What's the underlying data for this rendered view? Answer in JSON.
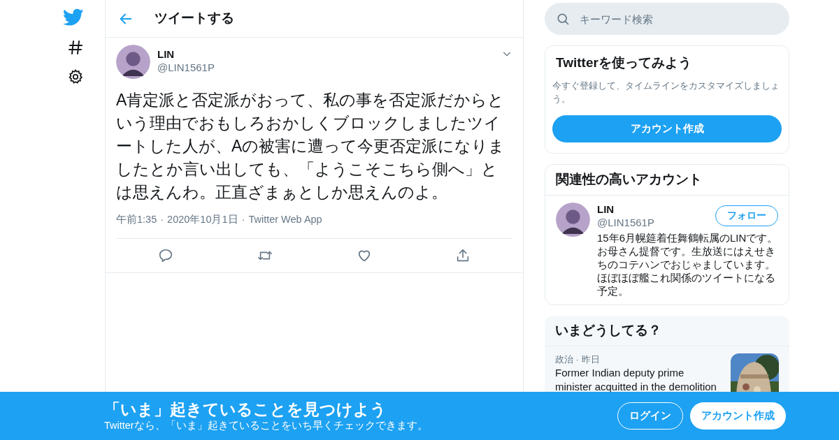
{
  "header": {
    "title": "ツイートする"
  },
  "tweet": {
    "name": "LIN",
    "handle": "@LIN1561P",
    "text": "A肯定派と否定派がおって、私の事を否定派だからという理由でおもしろおかしくブロックしましたツイートした人が、Aの被害に遭って今更否定派になりましたとか言い出しても、「ようこそこちら側へ」とは思えんわ。正直ざまぁとしか思えんのよ。",
    "meta": [
      "午前1:35",
      "·",
      "2020年10月1日",
      "·",
      "Twitter Web App"
    ]
  },
  "search": {
    "placeholder": "キーワード検索"
  },
  "signup_card": {
    "title": "Twitterを使ってみよう",
    "description": "今すぐ登録して、タイムラインをカスタマイズしましょう。",
    "button": "アカウント作成"
  },
  "related": {
    "title": "関連性の高いアカウント",
    "account": {
      "name": "LIN",
      "handle": "@LIN1561P",
      "button": "フォロー",
      "bio": "15年6月幌筵着任舞鶴転属のLINです。お母さん提督です。生放送にはえせきちのコテハンでおじゃましています。ほぼほぼ艦これ関係のツイートになる予定。"
    }
  },
  "trends": {
    "title": "いまどうしてる？",
    "items": [
      {
        "category": "政治 · 昨日",
        "text": "Former Indian deputy prime minister acquitted in the demolition",
        "kind": "picture"
      }
    ]
  },
  "banner": {
    "title": "「いま」起きていることを見つけよう",
    "subtitle": "Twitterなら、「いま」起きていることをいち早くチェックできます。",
    "buttons": [
      {
        "label": "ログイン",
        "kind": "outline"
      },
      {
        "label": "アカウント作成",
        "kind": "filled"
      }
    ]
  }
}
